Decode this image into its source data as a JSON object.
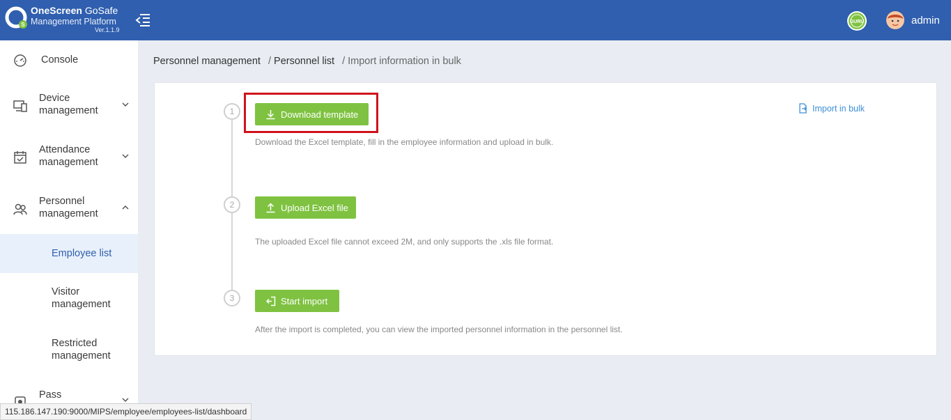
{
  "header": {
    "brand": "OneScreen",
    "product": "GoSafe",
    "subtitle": "Management Platform",
    "version": "Ver.1.1.9",
    "badge_text": "GURU",
    "username": "admin"
  },
  "sidebar": {
    "items": [
      {
        "label": "Console",
        "icon": "gauge-icon"
      },
      {
        "label": "Device management",
        "icon": "devices-icon",
        "expanded": false
      },
      {
        "label": "Attendance management",
        "icon": "calendar-check-icon",
        "expanded": false
      },
      {
        "label": "Personnel management",
        "icon": "users-icon",
        "expanded": true
      },
      {
        "label": "Pass",
        "icon": "pass-icon",
        "expanded": false
      }
    ],
    "subitems": [
      {
        "label": "Employee list",
        "active": true
      },
      {
        "label": "Visitor management",
        "active": false
      },
      {
        "label": "Restricted management",
        "active": false
      }
    ]
  },
  "breadcrumb": {
    "items": [
      "Personnel management",
      "Personnel list"
    ],
    "separator": "/",
    "current": "Import information in bulk"
  },
  "import_link": {
    "label": "Import in bulk"
  },
  "steps": [
    {
      "number": "1",
      "button": "Download template",
      "description": "Download the Excel template, fill in the employee information and upload in bulk."
    },
    {
      "number": "2",
      "button": "Upload Excel file",
      "description": "The uploaded Excel file cannot exceed 2M, and only supports the .xls file format."
    },
    {
      "number": "3",
      "button": "Start import",
      "description": "After the import is completed, you can view the imported personnel information in the personnel list."
    }
  ],
  "status_url": "115.186.147.190:9000/MIPS/employee/employees-list/dashboard",
  "colors": {
    "header": "#2f5fae",
    "button": "#7fc241",
    "highlight": "#d0121b",
    "link": "#3d8fd6",
    "active_bg": "#e8f0fb"
  }
}
